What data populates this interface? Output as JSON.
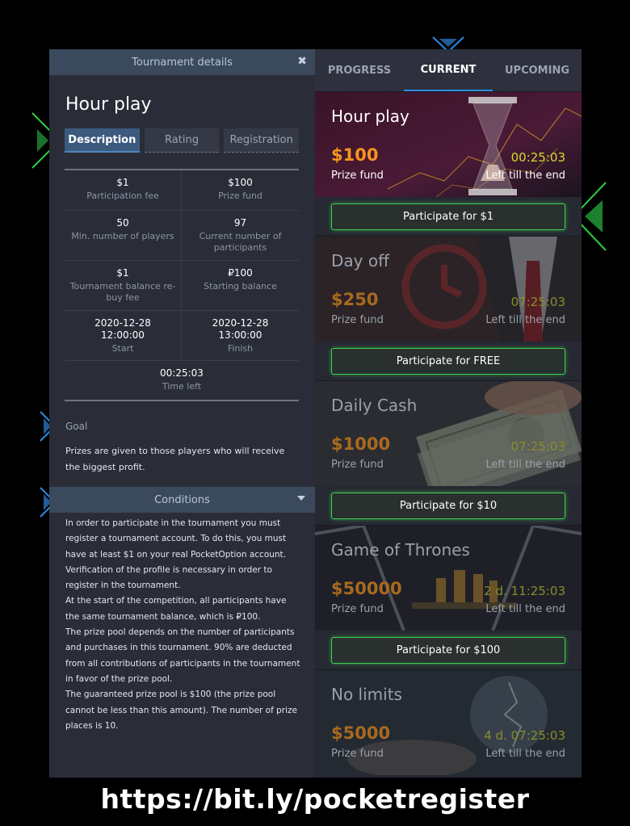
{
  "left": {
    "header_title": "Tournament details",
    "title": "Hour play",
    "subtabs": [
      "Description",
      "Rating",
      "Registration"
    ],
    "details": [
      {
        "value": "$1",
        "label": "Participation fee"
      },
      {
        "value": "$100",
        "label": "Prize fund"
      },
      {
        "value": "50",
        "label": "Min. number of players"
      },
      {
        "value": "97",
        "label": "Current number of participants"
      },
      {
        "value": "$1",
        "label": "Tournament balance re-buy fee"
      },
      {
        "value": "₽100",
        "label": "Starting balance"
      },
      {
        "value": "2020-12-28 12:00:00",
        "label": "Start"
      },
      {
        "value": "2020-12-28 13:00:00",
        "label": "Finish"
      },
      {
        "value": "00:25:03",
        "label": "Time left"
      }
    ],
    "goal_label": "Goal",
    "goal_text": "Prizes are given to those players who will receive the biggest profit.",
    "conditions_label": "Conditions",
    "conditions_text": [
      "In order to participate in the tournament you must register a tournament account. To do this, you must have at least $1 on your real PocketOption account. Verification of the profile is necessary in order to register in the tournament.",
      "At the start of the competition, all participants have the same tournament balance, which is ₽100.",
      "The prize pool depends on the number of participants and purchases in this tournament. 90% are deducted from all contributions of participants in the tournament in favor of the prize pool.",
      "The guaranteed prize pool is $100 (the prize pool cannot be less than this amount). The number of prize places is 10."
    ]
  },
  "right": {
    "tabs": [
      "PROGRESS",
      "CURRENT",
      "UPCOMING"
    ],
    "cards": [
      {
        "title": "Hour play",
        "prize": "$100",
        "prize_label": "Prize fund",
        "timer": "00:25:03",
        "timer_label": "Left till the end",
        "button": "Participate for $1"
      },
      {
        "title": "Day off",
        "prize": "$250",
        "prize_label": "Prize fund",
        "timer": "07:25:03",
        "timer_label": "Left till the end",
        "button": "Participate for FREE"
      },
      {
        "title": "Daily Cash",
        "prize": "$1000",
        "prize_label": "Prize fund",
        "timer": "07:25:03",
        "timer_label": "Left till the end",
        "button": "Participate for $10"
      },
      {
        "title": "Game of Thrones",
        "prize": "$50000",
        "prize_label": "Prize fund",
        "timer": "2 d. 11:25:03",
        "timer_label": "Left till the end",
        "button": "Participate for $100"
      },
      {
        "title": "No limits",
        "prize": "$5000",
        "prize_label": "Prize fund",
        "timer": "4 d. 07:25:03",
        "timer_label": "Left till the end"
      }
    ]
  },
  "footer_url": "https://bit.ly/pocketregister",
  "colors": {
    "accent_blue": "#2f8ae0",
    "prize_orange": "#f7941d",
    "timer_yellow": "#d8d92a",
    "button_green": "#3ed34f"
  }
}
